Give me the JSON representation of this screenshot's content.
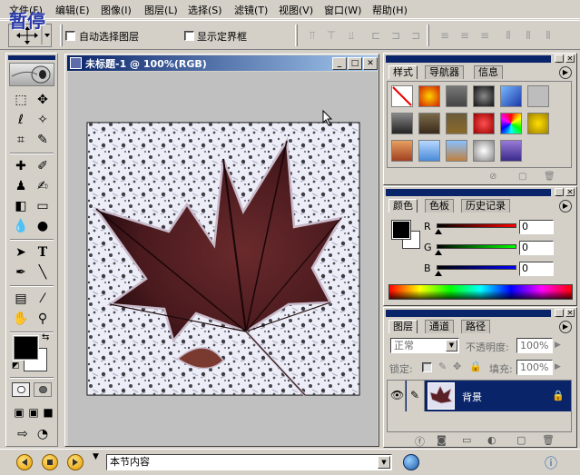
{
  "menu": {
    "items": [
      "文件(F)",
      "编辑(E)",
      "图像(I)",
      "图层(L)",
      "选择(S)",
      "滤镜(T)",
      "视图(V)",
      "窗口(W)",
      "帮助(H)"
    ],
    "overlay": "暂停"
  },
  "options": {
    "auto_select_label": "自动选择图层",
    "show_bounds_label": "显示定界框"
  },
  "document": {
    "title": "未标题-1 @ 100%(RGB)"
  },
  "styles_palette": {
    "tabs": [
      "样式",
      "导航器",
      "信息"
    ]
  },
  "color_palette": {
    "tabs": [
      "颜色",
      "色板",
      "历史记录"
    ],
    "channels": [
      {
        "label": "R",
        "value": "0",
        "gradient_start": "#000000",
        "gradient_end": "#ff0000"
      },
      {
        "label": "G",
        "value": "0",
        "gradient_start": "#000000",
        "gradient_end": "#00ff00"
      },
      {
        "label": "B",
        "value": "0",
        "gradient_start": "#000000",
        "gradient_end": "#0000ff"
      }
    ]
  },
  "layers_palette": {
    "tabs": [
      "图层",
      "通道",
      "路径"
    ],
    "blend_mode": "正常",
    "opacity_label": "不透明度:",
    "opacity_value": "100%",
    "lock_label": "锁定:",
    "fill_label": "填充:",
    "fill_value": "100%",
    "layer_name": "背景"
  },
  "statusbar": {
    "field_text": "本节内容"
  },
  "colors": {
    "titlebar_start": "#0a246a",
    "titlebar_end": "#a6caf0",
    "chrome": "#d4d0c8",
    "selected_layer": "#0a246a"
  }
}
